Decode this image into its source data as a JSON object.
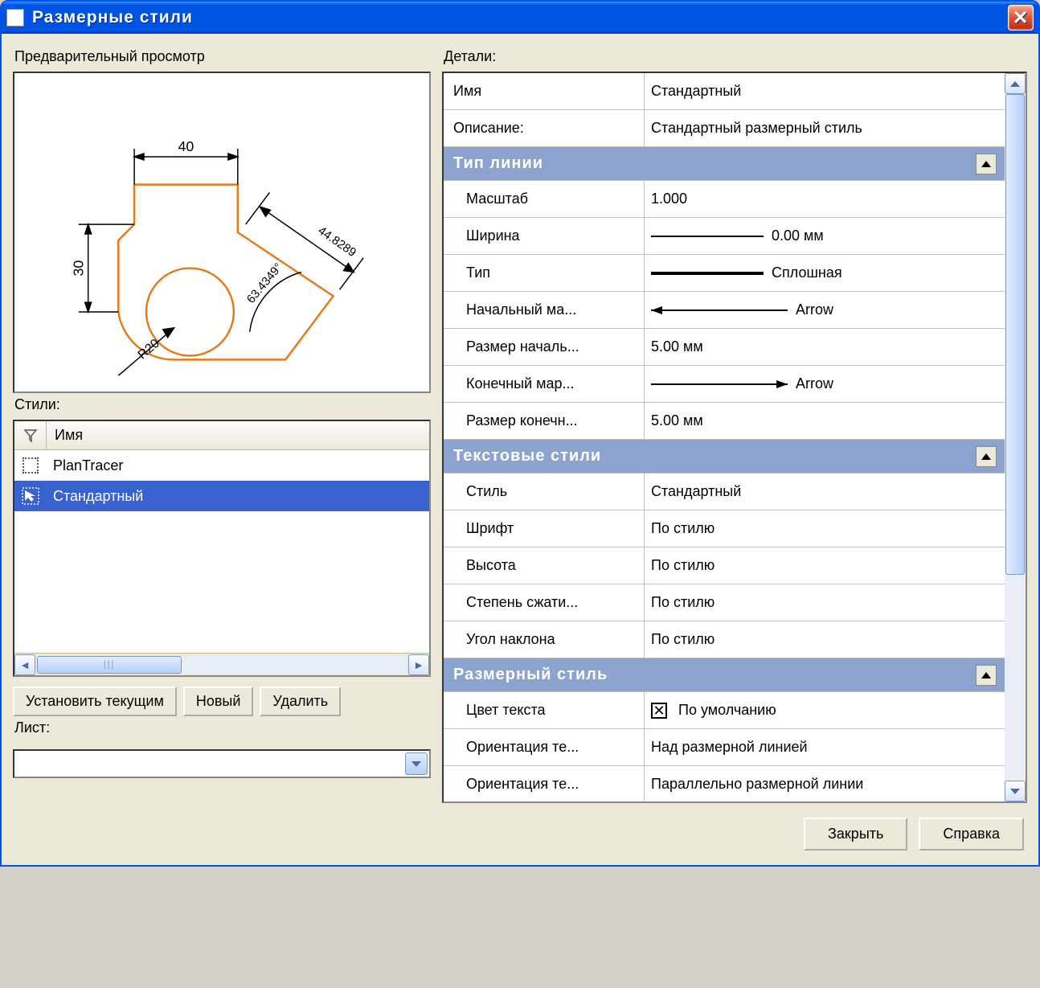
{
  "window": {
    "title": "Размерные стили"
  },
  "preview": {
    "label": "Предварительный просмотр",
    "dims": {
      "top": "40",
      "left": "30",
      "radius": "R20",
      "angle": "63.4349°",
      "diag": "44.8289"
    }
  },
  "styles": {
    "label": "Стили:",
    "column": "Имя",
    "items": [
      {
        "name": "PlanTracer",
        "selected": false
      },
      {
        "name": "Стандартный",
        "selected": true
      }
    ]
  },
  "buttons": {
    "set_current": "Установить текущим",
    "new": "Новый",
    "delete": "Удалить"
  },
  "sheet": {
    "label": "Лист:",
    "value": ""
  },
  "details": {
    "label": "Детали:",
    "rows": [
      {
        "type": "field",
        "name": "Имя",
        "value": "Стандартный"
      },
      {
        "type": "field",
        "name": "Описание:",
        "value": "Стандартный размерный стиль"
      },
      {
        "type": "group",
        "name": "Тип линии"
      },
      {
        "type": "child",
        "name": "Масштаб",
        "value": "1.000"
      },
      {
        "type": "child",
        "name": "Ширина",
        "value": "0.00 мм",
        "vis": "line"
      },
      {
        "type": "child",
        "name": "Тип",
        "value": "Сплошная",
        "vis": "thick"
      },
      {
        "type": "child",
        "name": "Начальный ма...",
        "value": "Arrow",
        "vis": "arrow-left"
      },
      {
        "type": "child",
        "name": "Размер началь...",
        "value": "5.00 мм"
      },
      {
        "type": "child",
        "name": "Конечный мар...",
        "value": "Arrow",
        "vis": "arrow-right"
      },
      {
        "type": "child",
        "name": "Размер конечн...",
        "value": "5.00 мм"
      },
      {
        "type": "group",
        "name": "Текстовые стили"
      },
      {
        "type": "child",
        "name": "Стиль",
        "value": "Стандартный"
      },
      {
        "type": "child",
        "name": "Шрифт",
        "value": "По стилю"
      },
      {
        "type": "child",
        "name": "Высота",
        "value": "По стилю"
      },
      {
        "type": "child",
        "name": "Степень сжати...",
        "value": "По стилю"
      },
      {
        "type": "child",
        "name": "Угол наклона",
        "value": "По стилю"
      },
      {
        "type": "group",
        "name": "Размерный стиль"
      },
      {
        "type": "child",
        "name": "Цвет текста",
        "value": "По умолчанию",
        "vis": "checkbox"
      },
      {
        "type": "child",
        "name": "Ориентация те...",
        "value": "Над размерной линией"
      },
      {
        "type": "child",
        "name": "Ориентация те...",
        "value": "Параллельно размерной линии"
      }
    ]
  },
  "footer": {
    "close": "Закрыть",
    "help": "Справка"
  }
}
